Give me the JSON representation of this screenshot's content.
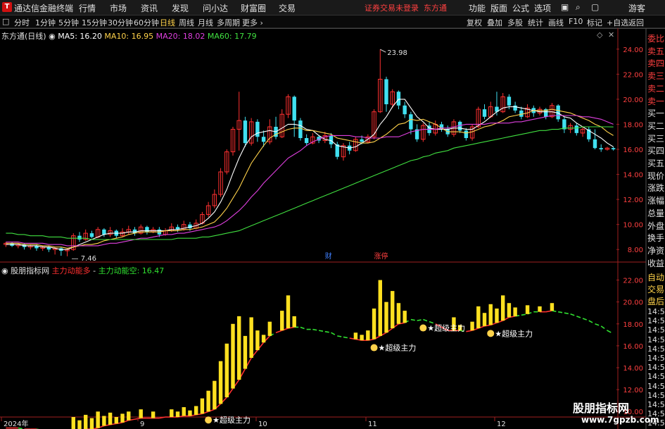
{
  "app": {
    "title": "通达信金融终端",
    "logo_glyph": "T"
  },
  "menu": [
    "行情",
    "市场",
    "资讯",
    "发现",
    "问小达",
    "财富圈",
    "交易"
  ],
  "login_warning": "证券交易未登录",
  "broker": "东方通",
  "right_menu": [
    "功能",
    "版面",
    "公式",
    "选项"
  ],
  "guest": "游客",
  "periods": [
    "分时",
    "1分钟",
    "5分钟",
    "15分钟",
    "30分钟",
    "60分钟",
    "日线",
    "周线",
    "月线",
    "多周期",
    "更多"
  ],
  "active_period": "日线",
  "right_tools": [
    "复权",
    "叠加",
    "多股",
    "统计",
    "画线",
    "F10",
    "标记",
    "+自选",
    "返回"
  ],
  "stock": {
    "name": "东方通(日线)"
  },
  "ma_legend": [
    {
      "label": "MA5: 16.20",
      "color": "#ffffff"
    },
    {
      "label": "MA10: 16.95",
      "color": "#ffd24a"
    },
    {
      "label": "MA20: 18.02",
      "color": "#e040e0"
    },
    {
      "label": "MA60: 17.79",
      "color": "#40e040"
    }
  ],
  "price_axis": [
    "24.00",
    "22.00",
    "20.00",
    "18.00",
    "16.00",
    "14.00",
    "12.00",
    "10.00",
    "8.00"
  ],
  "price_high_label": "23.98",
  "price_low_label": "7.46",
  "event_marks": [
    {
      "text": "财",
      "color": "#4080ff"
    },
    {
      "text": "涨停",
      "color": "#ff4040"
    }
  ],
  "indicator": {
    "name": "股朋指标网",
    "line1": "主力动能多",
    "line2": "主力动能空: 16.47",
    "axis": [
      "22.00",
      "20.00",
      "18.00",
      "16.00",
      "14.00",
      "12.00",
      "10.00"
    ],
    "signal_label": "超级主力"
  },
  "date_axis": [
    "2024年",
    "9",
    "10",
    "11",
    "12"
  ],
  "right_panel": {
    "items": [
      "委比",
      "卖五",
      "卖四",
      "卖三",
      "卖二",
      "卖一",
      "买一",
      "买二",
      "买三",
      "买四",
      "买五",
      "现价",
      "涨跌",
      "涨幅",
      "总量",
      "外盘",
      "换手",
      "净资",
      "收益"
    ],
    "lower": [
      "自动",
      "交易",
      "盘后"
    ],
    "times": [
      "14:56",
      "14:56",
      "14:56",
      "14:56",
      "14:56",
      "14:56",
      "14:56",
      "14:56",
      "14:56",
      "14:56",
      "14:56",
      "14:56",
      "14:56"
    ]
  },
  "watermark": {
    "line1": "股朋指标网",
    "line2": "www.7gpzb.com"
  },
  "chart_data": {
    "type": "candlestick",
    "ylim": [
      7,
      25
    ],
    "candles": [
      [
        8.4,
        8.5,
        8.2,
        8.6
      ],
      [
        8.5,
        8.3,
        8.2,
        8.6
      ],
      [
        8.3,
        8.4,
        8.1,
        8.5
      ],
      [
        8.4,
        8.2,
        8.0,
        8.5
      ],
      [
        8.2,
        8.3,
        8.0,
        8.4
      ],
      [
        8.3,
        8.1,
        7.9,
        8.4
      ],
      [
        8.1,
        8.2,
        7.9,
        8.3
      ],
      [
        8.2,
        8.0,
        7.8,
        8.3
      ],
      [
        8.0,
        8.1,
        7.6,
        8.2
      ],
      [
        8.1,
        7.9,
        7.5,
        8.2
      ],
      [
        7.9,
        8.0,
        7.46,
        8.1
      ],
      [
        8.0,
        9.1,
        7.9,
        9.3
      ],
      [
        9.1,
        8.8,
        8.6,
        9.4
      ],
      [
        8.8,
        9.3,
        8.7,
        9.6
      ],
      [
        9.3,
        9.0,
        8.9,
        9.5
      ],
      [
        9.0,
        9.6,
        8.9,
        9.8
      ],
      [
        9.6,
        9.2,
        9.0,
        9.7
      ],
      [
        9.2,
        9.5,
        9.0,
        9.8
      ],
      [
        9.5,
        9.1,
        8.9,
        9.6
      ],
      [
        9.1,
        9.4,
        9.0,
        9.7
      ],
      [
        9.4,
        9.6,
        9.2,
        9.9
      ],
      [
        9.6,
        9.3,
        9.1,
        9.8
      ],
      [
        9.3,
        9.8,
        9.2,
        10.0
      ],
      [
        9.8,
        9.4,
        9.2,
        9.9
      ],
      [
        9.4,
        9.6,
        9.3,
        9.8
      ],
      [
        9.6,
        9.2,
        9.0,
        9.8
      ],
      [
        9.2,
        9.5,
        9.1,
        9.7
      ],
      [
        9.5,
        9.8,
        9.4,
        10.1
      ],
      [
        9.8,
        9.6,
        9.4,
        10.0
      ],
      [
        9.6,
        10.0,
        9.5,
        10.3
      ],
      [
        10.0,
        9.7,
        9.5,
        10.2
      ],
      [
        9.7,
        10.1,
        9.6,
        10.4
      ],
      [
        10.1,
        10.8,
        10.0,
        11.0
      ],
      [
        10.8,
        11.5,
        10.6,
        11.8
      ],
      [
        11.5,
        12.4,
        11.3,
        12.8
      ],
      [
        12.4,
        14.2,
        12.2,
        14.5
      ],
      [
        14.2,
        15.8,
        14.0,
        16.0
      ],
      [
        15.8,
        17.6,
        15.5,
        17.8
      ],
      [
        17.6,
        18.3,
        15.9,
        20.6
      ],
      [
        18.3,
        16.5,
        16.2,
        18.6
      ],
      [
        16.5,
        18.2,
        16.3,
        18.5
      ],
      [
        18.2,
        17.0,
        16.6,
        18.4
      ],
      [
        17.0,
        16.6,
        16.2,
        17.5
      ],
      [
        16.6,
        17.8,
        16.4,
        18.4
      ],
      [
        17.8,
        17.0,
        16.8,
        18.6
      ],
      [
        17.0,
        18.8,
        16.9,
        19.2
      ],
      [
        18.8,
        20.2,
        18.5,
        20.4
      ],
      [
        20.2,
        18.3,
        17.0,
        20.3
      ],
      [
        18.3,
        16.9,
        16.7,
        18.5
      ],
      [
        16.9,
        16.5,
        16.3,
        17.2
      ],
      [
        16.5,
        17.0,
        16.4,
        17.3
      ],
      [
        17.0,
        16.7,
        16.5,
        17.1
      ],
      [
        16.7,
        17.1,
        16.5,
        17.4
      ],
      [
        17.1,
        16.4,
        16.1,
        17.3
      ],
      [
        16.4,
        15.4,
        15.2,
        16.6
      ],
      [
        15.4,
        16.3,
        15.1,
        16.5
      ],
      [
        16.3,
        15.9,
        15.6,
        16.6
      ],
      [
        15.9,
        16.8,
        15.8,
        17.0
      ],
      [
        16.8,
        16.6,
        16.4,
        17.1
      ],
      [
        16.6,
        17.0,
        16.5,
        17.2
      ],
      [
        17.0,
        19.0,
        16.8,
        19.2
      ],
      [
        19.0,
        21.6,
        18.9,
        23.98
      ],
      [
        21.6,
        19.6,
        19.0,
        21.8
      ],
      [
        19.6,
        20.6,
        19.3,
        20.8
      ],
      [
        20.6,
        19.5,
        19.2,
        20.7
      ],
      [
        19.5,
        18.8,
        18.5,
        19.8
      ],
      [
        18.8,
        17.6,
        17.2,
        19.0
      ],
      [
        17.6,
        16.8,
        16.6,
        18.0
      ],
      [
        16.8,
        17.9,
        16.6,
        18.1
      ],
      [
        17.9,
        17.3,
        17.1,
        18.2
      ],
      [
        17.3,
        18.0,
        17.1,
        18.3
      ],
      [
        18.0,
        17.6,
        17.4,
        18.2
      ],
      [
        17.6,
        17.2,
        17.0,
        17.9
      ],
      [
        17.2,
        18.2,
        17.0,
        18.4
      ],
      [
        18.2,
        17.5,
        17.3,
        18.3
      ],
      [
        17.5,
        16.9,
        16.7,
        17.7
      ],
      [
        16.9,
        17.8,
        16.7,
        18.0
      ],
      [
        17.8,
        19.2,
        17.7,
        19.4
      ],
      [
        19.2,
        18.6,
        18.4,
        19.6
      ],
      [
        18.6,
        19.4,
        18.5,
        19.8
      ],
      [
        19.4,
        19.0,
        18.7,
        20.6
      ],
      [
        19.0,
        20.2,
        18.9,
        20.5
      ],
      [
        20.2,
        19.5,
        19.2,
        20.4
      ],
      [
        19.5,
        19.1,
        18.9,
        19.8
      ],
      [
        19.1,
        18.6,
        18.4,
        19.4
      ],
      [
        18.6,
        19.3,
        18.5,
        19.6
      ],
      [
        19.3,
        18.9,
        18.6,
        19.5
      ],
      [
        18.9,
        19.2,
        18.7,
        19.4
      ],
      [
        19.2,
        18.6,
        18.4,
        19.3
      ],
      [
        18.6,
        19.5,
        18.5,
        19.7
      ],
      [
        19.5,
        18.4,
        18.2,
        19.6
      ],
      [
        18.4,
        17.6,
        17.3,
        18.6
      ],
      [
        17.6,
        17.9,
        17.3,
        18.1
      ],
      [
        17.9,
        17.3,
        17.1,
        18.1
      ],
      [
        17.3,
        17.6,
        17.0,
        17.8
      ],
      [
        17.6,
        16.8,
        16.6,
        17.8
      ],
      [
        16.8,
        16.1,
        16.0,
        17.6
      ],
      [
        16.1,
        16.0,
        15.8,
        16.4
      ],
      [
        16.0,
        16.1,
        15.9,
        16.2
      ],
      [
        16.1,
        16.0,
        15.9,
        16.2
      ]
    ],
    "ma5": [
      8.4,
      8.4,
      8.4,
      8.3,
      8.3,
      8.3,
      8.2,
      8.2,
      8.1,
      8.0,
      8.0,
      8.2,
      8.4,
      8.6,
      8.8,
      9.0,
      9.2,
      9.3,
      9.3,
      9.3,
      9.4,
      9.4,
      9.5,
      9.5,
      9.5,
      9.5,
      9.5,
      9.6,
      9.6,
      9.7,
      9.8,
      9.9,
      10.1,
      10.5,
      11.0,
      11.8,
      12.8,
      14.1,
      15.3,
      16.3,
      17.0,
      17.3,
      17.4,
      17.5,
      17.4,
      17.7,
      18.0,
      18.0,
      17.9,
      17.6,
      17.5,
      17.1,
      16.8,
      16.7,
      16.3,
      16.2,
      16.1,
      16.2,
      16.5,
      16.8,
      17.2,
      18.0,
      18.6,
      19.4,
      20.0,
      20.0,
      19.3,
      18.6,
      18.2,
      17.7,
      17.6,
      17.6,
      17.6,
      17.7,
      17.7,
      17.6,
      17.6,
      17.9,
      18.2,
      18.6,
      19.0,
      19.3,
      19.4,
      19.4,
      19.3,
      19.2,
      19.1,
      19.0,
      19.0,
      19.0,
      18.9,
      18.6,
      18.5,
      18.1,
      17.8,
      17.5,
      17.2,
      16.9,
      16.5,
      16.2
    ],
    "ma10": [
      8.5,
      8.5,
      8.5,
      8.4,
      8.4,
      8.4,
      8.3,
      8.3,
      8.2,
      8.2,
      8.1,
      8.2,
      8.3,
      8.4,
      8.4,
      8.5,
      8.7,
      8.8,
      8.9,
      9.0,
      9.2,
      9.3,
      9.4,
      9.4,
      9.4,
      9.4,
      9.5,
      9.5,
      9.5,
      9.6,
      9.6,
      9.7,
      9.8,
      10.0,
      10.2,
      10.7,
      11.3,
      12.1,
      12.9,
      13.9,
      14.9,
      15.6,
      16.3,
      16.9,
      17.2,
      17.4,
      17.6,
      17.7,
      17.7,
      17.5,
      17.5,
      17.4,
      17.3,
      17.2,
      16.9,
      16.8,
      16.7,
      16.6,
      16.5,
      16.5,
      16.6,
      16.9,
      17.2,
      17.6,
      18.0,
      18.1,
      18.4,
      18.3,
      18.4,
      18.2,
      18.0,
      17.7,
      17.4,
      17.4,
      17.4,
      17.3,
      17.4,
      17.6,
      17.8,
      17.9,
      18.1,
      18.3,
      18.6,
      18.7,
      18.8,
      18.9,
      19.1,
      19.1,
      19.1,
      19.2,
      19.1,
      19.0,
      18.9,
      18.7,
      18.5,
      18.3,
      18.0,
      17.8,
      17.4,
      17.1
    ],
    "ma20": [
      8.6,
      8.6,
      8.6,
      8.5,
      8.5,
      8.5,
      8.5,
      8.4,
      8.4,
      8.4,
      8.3,
      8.3,
      8.3,
      8.3,
      8.3,
      8.3,
      8.4,
      8.5,
      8.5,
      8.6,
      8.7,
      8.8,
      8.9,
      8.9,
      9.0,
      9.1,
      9.2,
      9.2,
      9.3,
      9.3,
      9.4,
      9.5,
      9.6,
      9.7,
      9.8,
      10.0,
      10.3,
      10.7,
      11.1,
      11.6,
      12.2,
      12.7,
      13.3,
      13.8,
      14.3,
      14.8,
      15.3,
      15.6,
      15.9,
      16.3,
      16.6,
      16.8,
      17.0,
      17.1,
      17.1,
      17.1,
      17.1,
      17.0,
      17.0,
      16.9,
      16.9,
      16.9,
      17.0,
      17.0,
      17.0,
      17.2,
      17.4,
      17.5,
      17.6,
      17.6,
      17.6,
      17.7,
      17.7,
      17.8,
      17.9,
      18.0,
      18.0,
      18.0,
      18.0,
      18.1,
      18.1,
      18.1,
      18.1,
      18.2,
      18.2,
      18.3,
      18.4,
      18.5,
      18.6,
      18.7,
      18.7,
      18.7,
      18.7,
      18.7,
      18.6,
      18.6,
      18.5,
      18.4,
      18.2,
      18.0
    ],
    "ma60": [
      9.3,
      9.3,
      9.2,
      9.2,
      9.1,
      9.1,
      9.1,
      9.0,
      9.0,
      9.0,
      8.9,
      8.9,
      8.9,
      8.9,
      8.8,
      8.8,
      8.8,
      8.8,
      8.8,
      8.8,
      8.8,
      8.8,
      8.8,
      8.8,
      8.8,
      8.8,
      8.8,
      8.8,
      8.9,
      8.9,
      8.9,
      8.9,
      9.0,
      9.0,
      9.1,
      9.2,
      9.3,
      9.4,
      9.5,
      9.7,
      9.9,
      10.1,
      10.3,
      10.5,
      10.7,
      10.9,
      11.1,
      11.3,
      11.5,
      11.7,
      11.9,
      12.1,
      12.3,
      12.5,
      12.7,
      12.9,
      13.1,
      13.3,
      13.5,
      13.7,
      13.9,
      14.1,
      14.3,
      14.5,
      14.7,
      14.9,
      15.1,
      15.2,
      15.4,
      15.5,
      15.7,
      15.8,
      15.9,
      16.1,
      16.2,
      16.3,
      16.4,
      16.5,
      16.6,
      16.7,
      16.8,
      16.9,
      17.0,
      17.1,
      17.2,
      17.3,
      17.4,
      17.5,
      17.5,
      17.6,
      17.6,
      17.7,
      17.7,
      17.7,
      17.8,
      17.8,
      17.8,
      17.8,
      17.8,
      17.79
    ]
  }
}
